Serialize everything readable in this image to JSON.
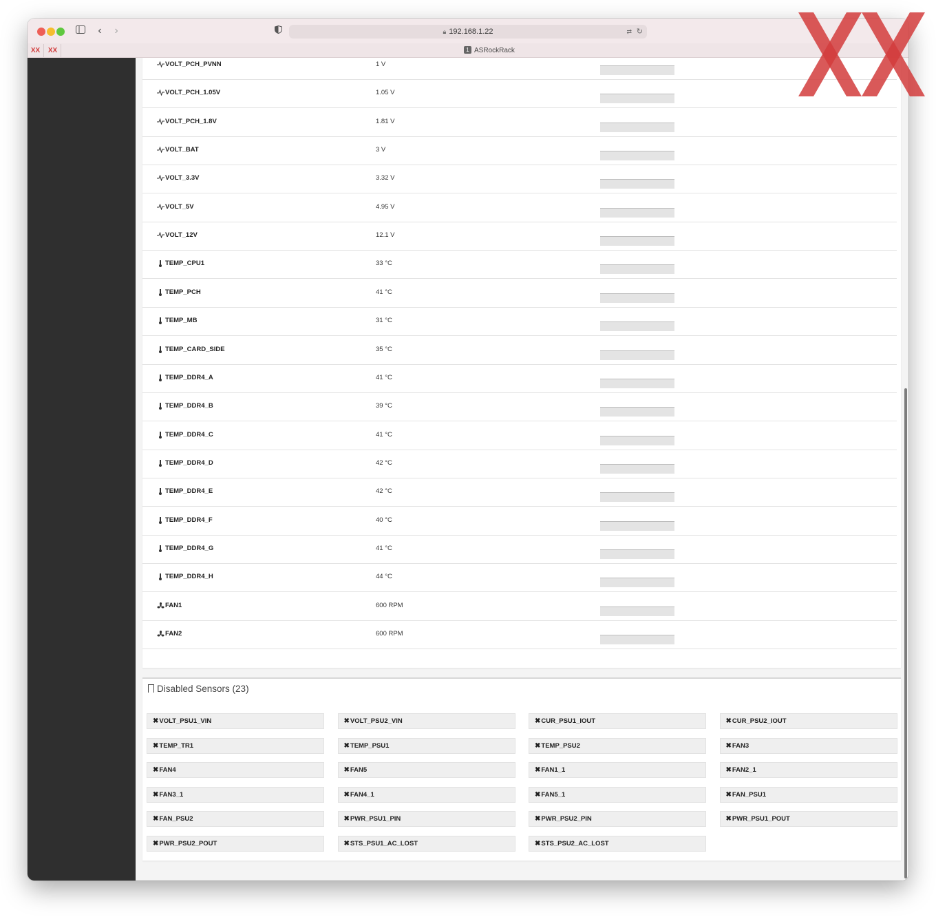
{
  "browser": {
    "url": "192.168.1.22",
    "tab_title": "ASRockRack",
    "tab_number": "1",
    "pinned_tabs": [
      "XX",
      "XX"
    ]
  },
  "sensors": [
    {
      "icon": "voltage-icon",
      "name": "VOLT_PCH_PVNN",
      "value": "1 V"
    },
    {
      "icon": "voltage-icon",
      "name": "VOLT_PCH_1.05V",
      "value": "1.05 V"
    },
    {
      "icon": "voltage-icon",
      "name": "VOLT_PCH_1.8V",
      "value": "1.81 V"
    },
    {
      "icon": "voltage-icon",
      "name": "VOLT_BAT",
      "value": "3 V"
    },
    {
      "icon": "voltage-icon",
      "name": "VOLT_3.3V",
      "value": "3.32 V"
    },
    {
      "icon": "voltage-icon",
      "name": "VOLT_5V",
      "value": "4.95 V"
    },
    {
      "icon": "voltage-icon",
      "name": "VOLT_12V",
      "value": "12.1 V"
    },
    {
      "icon": "thermometer-icon",
      "name": "TEMP_CPU1",
      "value": "33 °C"
    },
    {
      "icon": "thermometer-icon",
      "name": "TEMP_PCH",
      "value": "41 °C"
    },
    {
      "icon": "thermometer-icon",
      "name": "TEMP_MB",
      "value": "31 °C"
    },
    {
      "icon": "thermometer-icon",
      "name": "TEMP_CARD_SIDE",
      "value": "35 °C"
    },
    {
      "icon": "thermometer-icon",
      "name": "TEMP_DDR4_A",
      "value": "41 °C"
    },
    {
      "icon": "thermometer-icon",
      "name": "TEMP_DDR4_B",
      "value": "39 °C"
    },
    {
      "icon": "thermometer-icon",
      "name": "TEMP_DDR4_C",
      "value": "41 °C"
    },
    {
      "icon": "thermometer-icon",
      "name": "TEMP_DDR4_D",
      "value": "42 °C"
    },
    {
      "icon": "thermometer-icon",
      "name": "TEMP_DDR4_E",
      "value": "42 °C"
    },
    {
      "icon": "thermometer-icon",
      "name": "TEMP_DDR4_F",
      "value": "40 °C"
    },
    {
      "icon": "thermometer-icon",
      "name": "TEMP_DDR4_G",
      "value": "41 °C"
    },
    {
      "icon": "thermometer-icon",
      "name": "TEMP_DDR4_H",
      "value": "44 °C"
    },
    {
      "icon": "fan-icon",
      "name": "FAN1",
      "value": "600 RPM"
    },
    {
      "icon": "fan-icon",
      "name": "FAN2",
      "value": "600 RPM"
    }
  ],
  "disabled": {
    "title": "Disabled Sensors (23)",
    "items": [
      "VOLT_PSU1_VIN",
      "VOLT_PSU2_VIN",
      "CUR_PSU1_IOUT",
      "CUR_PSU2_IOUT",
      "TEMP_TR1",
      "TEMP_PSU1",
      "TEMP_PSU2",
      "FAN3",
      "FAN4",
      "FAN5",
      "FAN1_1",
      "FAN2_1",
      "FAN3_1",
      "FAN4_1",
      "FAN5_1",
      "FAN_PSU1",
      "FAN_PSU2",
      "PWR_PSU1_PIN",
      "PWR_PSU2_PIN",
      "PWR_PSU1_POUT",
      "PWR_PSU2_POUT",
      "STS_PSU1_AC_LOST",
      "STS_PSU2_AC_LOST"
    ]
  },
  "colors": {
    "sidebar": "#2f2f2f",
    "logo_red": "#d23c3c"
  }
}
